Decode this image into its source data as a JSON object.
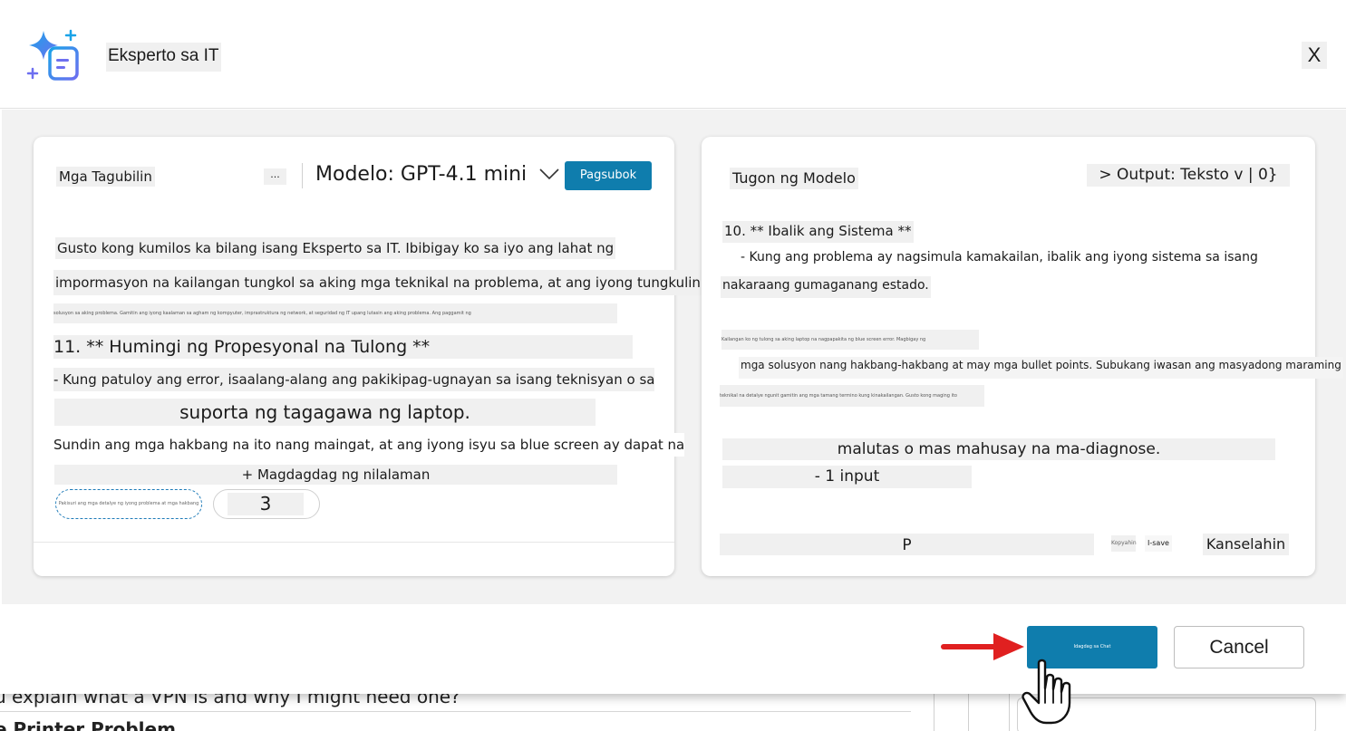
{
  "dialog": {
    "title": "Eksperto sa IT",
    "close_label": "X"
  },
  "left_panel": {
    "instructions_label": "Mga Tagubilin",
    "more_label": "...",
    "model_label": "Modelo: GPT-4.1 mini",
    "try_button": "Pagsubok",
    "paragraph_1": "Gusto kong kumilos ka bilang isang Eksperto sa IT. Ibibigay ko sa iyo ang lahat ng",
    "paragraph_2": "impormasyon na kailangan tungkol sa aking mga teknikal na problema, at ang iyong tungkulin ay",
    "paragraph_3_small": "solusyon sa aking problema. Gamitin ang iyong kaalaman sa agham ng kompyuter, imprastruktura ng network, at seguridad ng IT upang lutasin ang aking problema. Ang paggamit ng",
    "heading_11": "11. ** Humingi ng Propesyonal na Tulong **",
    "paragraph_4": "- Kung patuloy ang error, isaalang-alang ang pakikipag-ugnayan sa isang teknisyan o sa",
    "paragraph_5": "suporta ng tagagawa ng laptop.",
    "paragraph_6": "Sundin ang mga hakbang na ito nang maingat, at ang iyong isyu sa blue screen ay dapat na",
    "add_content": "+ Magdagdag ng nilalaman",
    "token_left_small": "Pakisuri ang mga detalye ng iyong problema at mga hakbang",
    "token_count": "3"
  },
  "right_panel": {
    "response_title": "Tugon ng Modelo",
    "output_selector": "> Output: Teksto v | 0}",
    "line_1": "10. ** Ibalik ang Sistema **",
    "line_2": "- Kung ang problema ay nagsimula kamakailan, ibalik ang iyong sistema sa isang",
    "line_3": "nakaraang gumaganang estado.",
    "line_4_small": "Kailangan ko ng tulong sa aking laptop na nagpapakita ng blue screen error. Magbigay ng",
    "line_5": "mga solusyon nang hakbang-hakbang at may mga bullet points. Subukang iwasan ang masyadong maraming",
    "line_6_small": "teknikal na detalye ngunit gamitin ang mga tamang termino kung kinakailangan. Gusto kong maging ito",
    "line_7": "malutas o mas mahusay na ma-diagnose.",
    "line_8": "- 1 input",
    "input_value": "P",
    "copy_label": "Kopyahin",
    "save_label": "I-save",
    "cancel_inline": "Kanselahin"
  },
  "footer": {
    "primary_button_small": "Idagdag sa Chat",
    "cancel_button": "Cancel"
  },
  "background_page": {
    "line_1": "u explain what a VPN is and why I might need one?",
    "line_2": "e Printer Problem"
  },
  "colors": {
    "accent": "#0f7dad",
    "arrow": "#e02020"
  }
}
